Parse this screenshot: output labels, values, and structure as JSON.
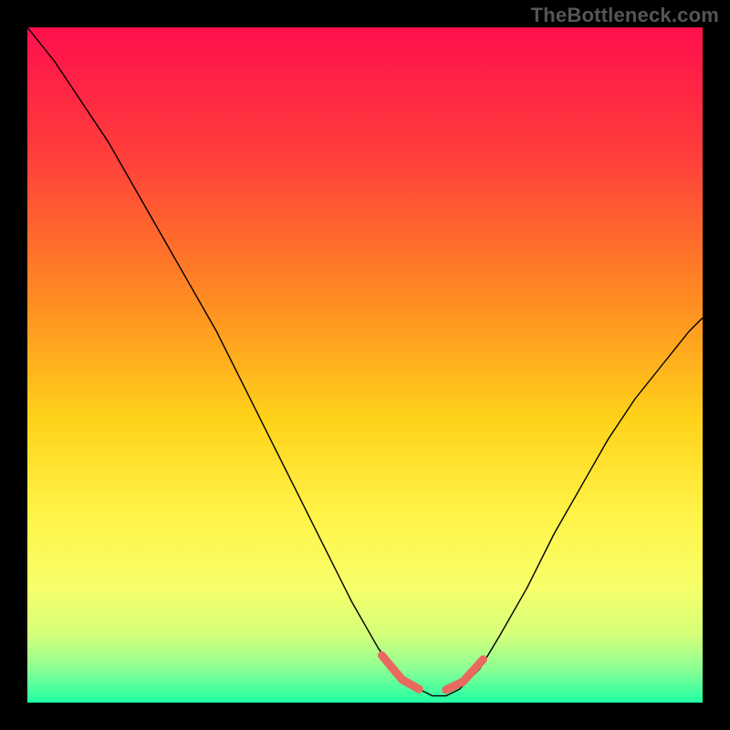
{
  "watermark": "TheBottleneck.com",
  "chart_data": {
    "type": "line",
    "title": "",
    "xlabel": "",
    "ylabel": "",
    "xlim": [
      0,
      100
    ],
    "ylim": [
      0,
      100
    ],
    "background_gradient": {
      "stops": [
        {
          "offset": 0,
          "color": "#ff0f4d"
        },
        {
          "offset": 0.19,
          "color": "#ff3e3b"
        },
        {
          "offset": 0.4,
          "color": "#ff8a22"
        },
        {
          "offset": 0.58,
          "color": "#ffd21a"
        },
        {
          "offset": 0.72,
          "color": "#fff347"
        },
        {
          "offset": 0.83,
          "color": "#f7ff6a"
        },
        {
          "offset": 0.9,
          "color": "#d4ff7a"
        },
        {
          "offset": 0.95,
          "color": "#8bff94"
        },
        {
          "offset": 1.0,
          "color": "#1fffa4"
        }
      ]
    },
    "series": [
      {
        "name": "curve",
        "color": "#000000",
        "width": 1.4,
        "x": [
          0,
          4,
          8,
          12,
          16,
          20,
          24,
          28,
          32,
          36,
          40,
          44,
          48,
          52,
          55,
          58,
          60,
          62,
          64,
          67,
          70,
          74,
          78,
          82,
          86,
          90,
          94,
          98,
          100
        ],
        "y": [
          100,
          95,
          89,
          83,
          76,
          69,
          62,
          55,
          47,
          39,
          31,
          23,
          15,
          8,
          4,
          2,
          1,
          1,
          2,
          5,
          10,
          17,
          25,
          32,
          39,
          45,
          50,
          55,
          57
        ]
      },
      {
        "name": "highlight-left",
        "color": "#e9695e",
        "width": 9,
        "linecap": "round",
        "x": [
          52.5,
          55.5,
          58.0
        ],
        "y": [
          7.0,
          3.4,
          2.0
        ]
      },
      {
        "name": "highlight-right",
        "color": "#e9695e",
        "width": 9,
        "linecap": "round",
        "x": [
          62.0,
          64.5,
          67.5
        ],
        "y": [
          1.9,
          3.1,
          6.4
        ]
      }
    ]
  }
}
